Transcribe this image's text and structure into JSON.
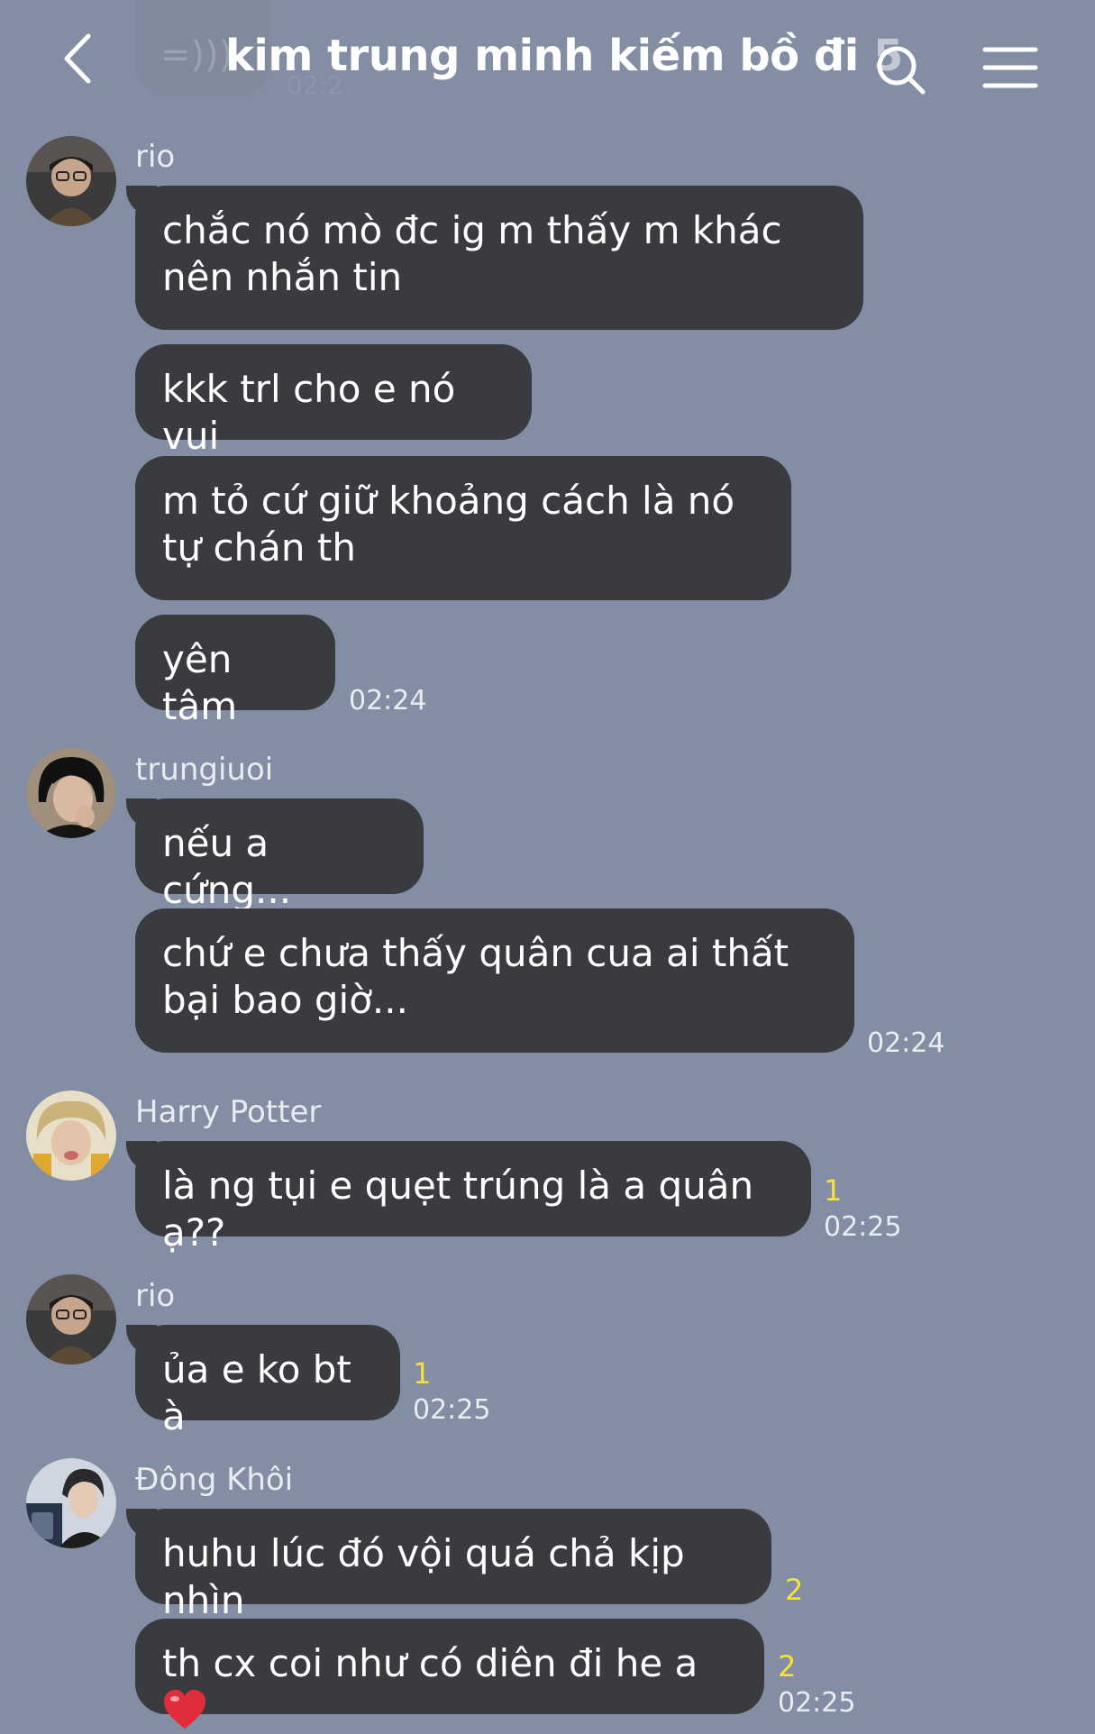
{
  "header": {
    "ghost_preview_text": "=)))",
    "ghost_preview_time": "02:2",
    "title": "kim trung minh kiếm bồ đi",
    "member_count": "5"
  },
  "messages": [
    {
      "sender": "rio",
      "avatar": "avatar-photo",
      "texts": [
        "chắc nó mò đc ig m thấy m khác nên nhắn tin",
        "kkk trl cho e nó vui",
        "m tỏ cứ giữ khoảng cách là nó tự chán th",
        "yên tâm"
      ],
      "time": "02:24"
    },
    {
      "sender": "trungiuoi",
      "avatar": "avatar-photo",
      "texts": [
        "nếu a cứng...",
        "chứ e chưa thấy quân cua ai thất bại bao giờ..."
      ],
      "time": "02:24"
    },
    {
      "sender": "Harry Potter",
      "avatar": "avatar-photo",
      "texts": [
        "là ng tụi e quẹt trúng là a quân ạ??"
      ],
      "unread": "1",
      "time": "02:25"
    },
    {
      "sender": "rio",
      "avatar": "avatar-photo",
      "texts": [
        "ủa e ko bt à"
      ],
      "unread": "1",
      "time": "02:25"
    },
    {
      "sender": "Đông Khôi",
      "avatar": "avatar-photo",
      "texts": [
        "huhu lúc đó vội quá chả kịp nhìn",
        "th cx coi như có diên đi he a"
      ],
      "unread_1": "2",
      "unread_2": "2",
      "time": "02:25",
      "emoji": "heart-emoji"
    }
  ],
  "colors": {
    "background": "#838da3",
    "bubble": "#3a3b3f",
    "unread": "#f5e13a"
  }
}
